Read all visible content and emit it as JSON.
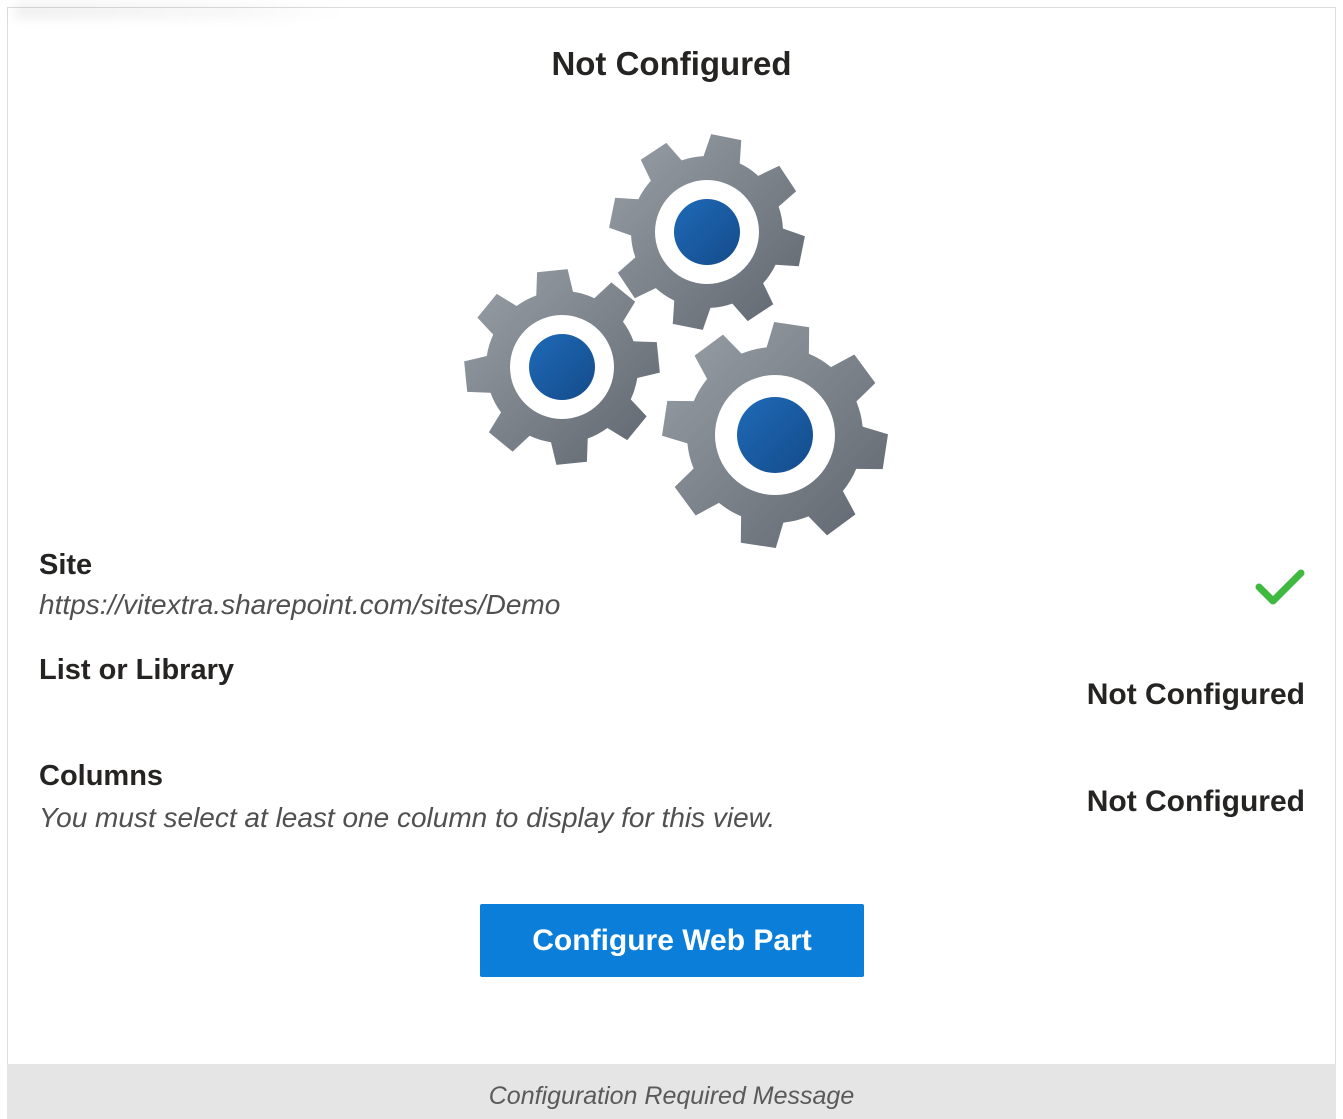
{
  "header": {
    "title": "Not Configured"
  },
  "illustration": {
    "icon": "gears-icon",
    "gear_colors": [
      "#8a8f96",
      "#6b717a"
    ],
    "hub_color": "#1a5aa0"
  },
  "settings": {
    "site": {
      "label": "Site",
      "value": "https://vitextra.sharepoint.com/sites/Demo",
      "status_icon": "check-icon",
      "status_color": "#3fb93f"
    },
    "list": {
      "label": "List or Library",
      "status": "Not Configured"
    },
    "columns": {
      "label": "Columns",
      "description": "You must select at least one column to display for this view.",
      "status": "Not Configured"
    }
  },
  "actions": {
    "configure_label": "Configure Web Part",
    "accent_color": "#0a7ed8"
  },
  "caption": {
    "text": "Configuration Required Message"
  }
}
